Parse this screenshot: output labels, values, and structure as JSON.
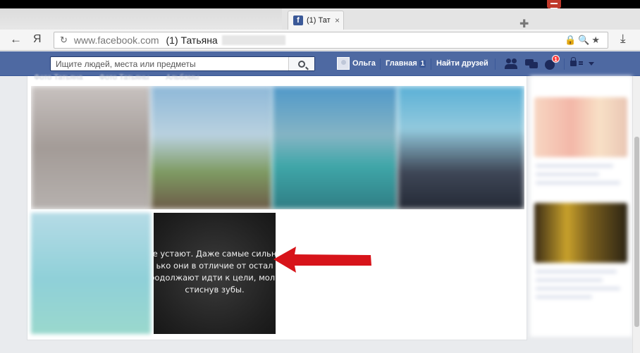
{
  "browser": {
    "tab": {
      "favicon_letter": "f",
      "title": "(1) Тат",
      "close_glyph": "×"
    },
    "new_tab_glyph": "✚",
    "back_glyph": "←",
    "yandex_logo": "Я",
    "address": {
      "reload_glyph": "↻",
      "host": "www.facebook.com",
      "title": "(1) Татьяна",
      "icons": "🔒🔍★"
    },
    "download_glyph": "⤓"
  },
  "facebook": {
    "search": {
      "placeholder": "Ищите людей, места или предметы"
    },
    "nav": {
      "user": "Ольга",
      "home": "Главная",
      "home_count": "1",
      "find_friends": "Найти друзей"
    },
    "notifications_count": "1",
    "subtabs": [
      "Фото Татьяна",
      "Фото Татьяны",
      "Альбомы"
    ],
    "quote": "е устают. Даже самые сильн\nько они в отличие от остал\nродолжают идти к цели, молч\nстиснув зубы."
  },
  "colors": {
    "fb_blue": "#4e69a2",
    "arrow_red": "#d7141a",
    "badge_red": "#fa3e3e"
  }
}
